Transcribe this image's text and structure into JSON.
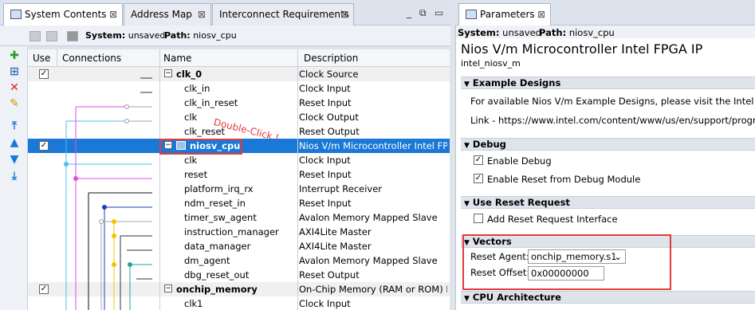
{
  "tabs_left": [
    {
      "label": "System Contents",
      "active": true
    },
    {
      "label": "Address Map",
      "active": false
    },
    {
      "label": "Interconnect Requirements",
      "active": false
    }
  ],
  "tabs_right": [
    {
      "label": "Parameters",
      "active": true
    }
  ],
  "window_controls": {
    "minimize": "_",
    "restore": "□",
    "maximize": "▫"
  },
  "system_bar": {
    "system_label": "System:",
    "system_value": "unsaved",
    "path_label": "Path:",
    "path_value": "niosv_cpu"
  },
  "columns": {
    "use": "Use",
    "connections": "Connections",
    "name": "Name",
    "description": "Description"
  },
  "rows": [
    {
      "name": "clk_0",
      "desc": "Clock Source",
      "type": "group",
      "checked": true
    },
    {
      "name": "clk_in",
      "desc": "Clock Input",
      "type": "port"
    },
    {
      "name": "clk_in_reset",
      "desc": "Reset Input",
      "type": "port"
    },
    {
      "name": "clk",
      "desc": "Clock Output",
      "type": "port"
    },
    {
      "name": "clk_reset",
      "desc": "Reset Output",
      "type": "port"
    },
    {
      "name": "niosv_cpu",
      "desc": "Nios V/m Microcontroller Intel FPGA",
      "type": "group",
      "checked": true,
      "selected": true
    },
    {
      "name": "clk",
      "desc": "Clock Input",
      "type": "port"
    },
    {
      "name": "reset",
      "desc": "Reset Input",
      "type": "port"
    },
    {
      "name": "platform_irq_rx",
      "desc": "Interrupt Receiver",
      "type": "port"
    },
    {
      "name": "ndm_reset_in",
      "desc": "Reset Input",
      "type": "port"
    },
    {
      "name": "timer_sw_agent",
      "desc": "Avalon Memory Mapped Slave",
      "type": "port"
    },
    {
      "name": "instruction_manager",
      "desc": "AXI4Lite Master",
      "type": "port"
    },
    {
      "name": "data_manager",
      "desc": "AXI4Lite Master",
      "type": "port"
    },
    {
      "name": "dm_agent",
      "desc": "Avalon Memory Mapped Slave",
      "type": "port"
    },
    {
      "name": "dbg_reset_out",
      "desc": "Reset Output",
      "type": "port"
    },
    {
      "name": "onchip_memory",
      "desc": "On-Chip Memory (RAM or ROM) Int",
      "type": "group",
      "checked": true
    },
    {
      "name": "clk1",
      "desc": "Clock Input",
      "type": "port"
    }
  ],
  "annotation": "Double-Click !",
  "params": {
    "title": "Nios V/m Microcontroller Intel FPGA IP",
    "subtitle": "intel_niosv_m",
    "system_label": "System:",
    "system_value": "unsaved",
    "path_label": "Path:",
    "path_value": "niosv_cpu",
    "sections": {
      "example": "Example Designs",
      "debug": "Debug",
      "reset_req": "Use Reset Request",
      "vectors": "Vectors",
      "cpu_arch": "CPU Architecture"
    },
    "example_text": "For available Nios V/m Example Designs, please visit the Intel Design",
    "example_link": "Link - https://www.intel.com/content/www/us/en/support/programma",
    "enable_debug": "Enable Debug",
    "enable_debug_checked": true,
    "enable_reset_debug": "Enable Reset from Debug Module",
    "enable_reset_debug_checked": true,
    "add_reset_req": "Add Reset Request Interface",
    "add_reset_req_checked": false,
    "reset_agent_label": "Reset Agent:",
    "reset_agent_value": "onchip_memory.s1",
    "reset_offset_label": "Reset Offset:",
    "reset_offset_value": "0x00000000"
  }
}
